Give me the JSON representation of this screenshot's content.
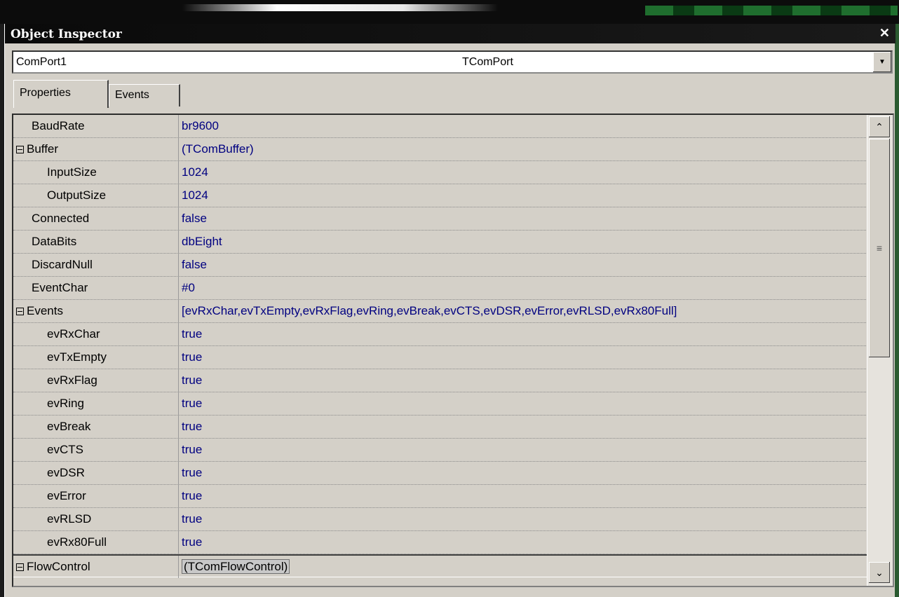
{
  "window": {
    "title": "Object Inspector",
    "close_glyph": "✕"
  },
  "selector": {
    "component_name": "ComPort1",
    "component_type": "TComPort",
    "dropdown_icon": "chevron-down-icon"
  },
  "tabs": [
    {
      "label": "Properties",
      "active": true
    },
    {
      "label": "Events",
      "active": false
    }
  ],
  "properties": [
    {
      "name": "BaudRate",
      "value": "br9600",
      "indent": 0,
      "expander": false
    },
    {
      "name": "Buffer",
      "value": "(TComBuffer)",
      "indent": 0,
      "expander": true
    },
    {
      "name": "InputSize",
      "value": "1024",
      "indent": 1,
      "expander": false
    },
    {
      "name": "OutputSize",
      "value": "1024",
      "indent": 1,
      "expander": false
    },
    {
      "name": "Connected",
      "value": "false",
      "indent": 0,
      "expander": false
    },
    {
      "name": "DataBits",
      "value": "dbEight",
      "indent": 0,
      "expander": false
    },
    {
      "name": "DiscardNull",
      "value": "false",
      "indent": 0,
      "expander": false
    },
    {
      "name": "EventChar",
      "value": "#0",
      "indent": 0,
      "expander": false
    },
    {
      "name": "Events",
      "value": "[evRxChar,evTxEmpty,evRxFlag,evRing,evBreak,evCTS,evDSR,evError,evRLSD,evRx80Full]",
      "indent": 0,
      "expander": true
    },
    {
      "name": "evRxChar",
      "value": "true",
      "indent": 1,
      "expander": false
    },
    {
      "name": "evTxEmpty",
      "value": "true",
      "indent": 1,
      "expander": false
    },
    {
      "name": "evRxFlag",
      "value": "true",
      "indent": 1,
      "expander": false
    },
    {
      "name": "evRing",
      "value": "true",
      "indent": 1,
      "expander": false
    },
    {
      "name": "evBreak",
      "value": "true",
      "indent": 1,
      "expander": false
    },
    {
      "name": "evCTS",
      "value": "true",
      "indent": 1,
      "expander": false
    },
    {
      "name": "evDSR",
      "value": "true",
      "indent": 1,
      "expander": false
    },
    {
      "name": "evError",
      "value": "true",
      "indent": 1,
      "expander": false
    },
    {
      "name": "evRLSD",
      "value": "true",
      "indent": 1,
      "expander": false
    },
    {
      "name": "evRx80Full",
      "value": "true",
      "indent": 1,
      "expander": false
    },
    {
      "name": "FlowControl",
      "value": "(TComFlowControl)",
      "indent": 0,
      "expander": true,
      "selected": true
    }
  ],
  "colors": {
    "value_text": "#000080",
    "panel": "#d4d0c8",
    "titlebar": "#0a0a0a"
  }
}
